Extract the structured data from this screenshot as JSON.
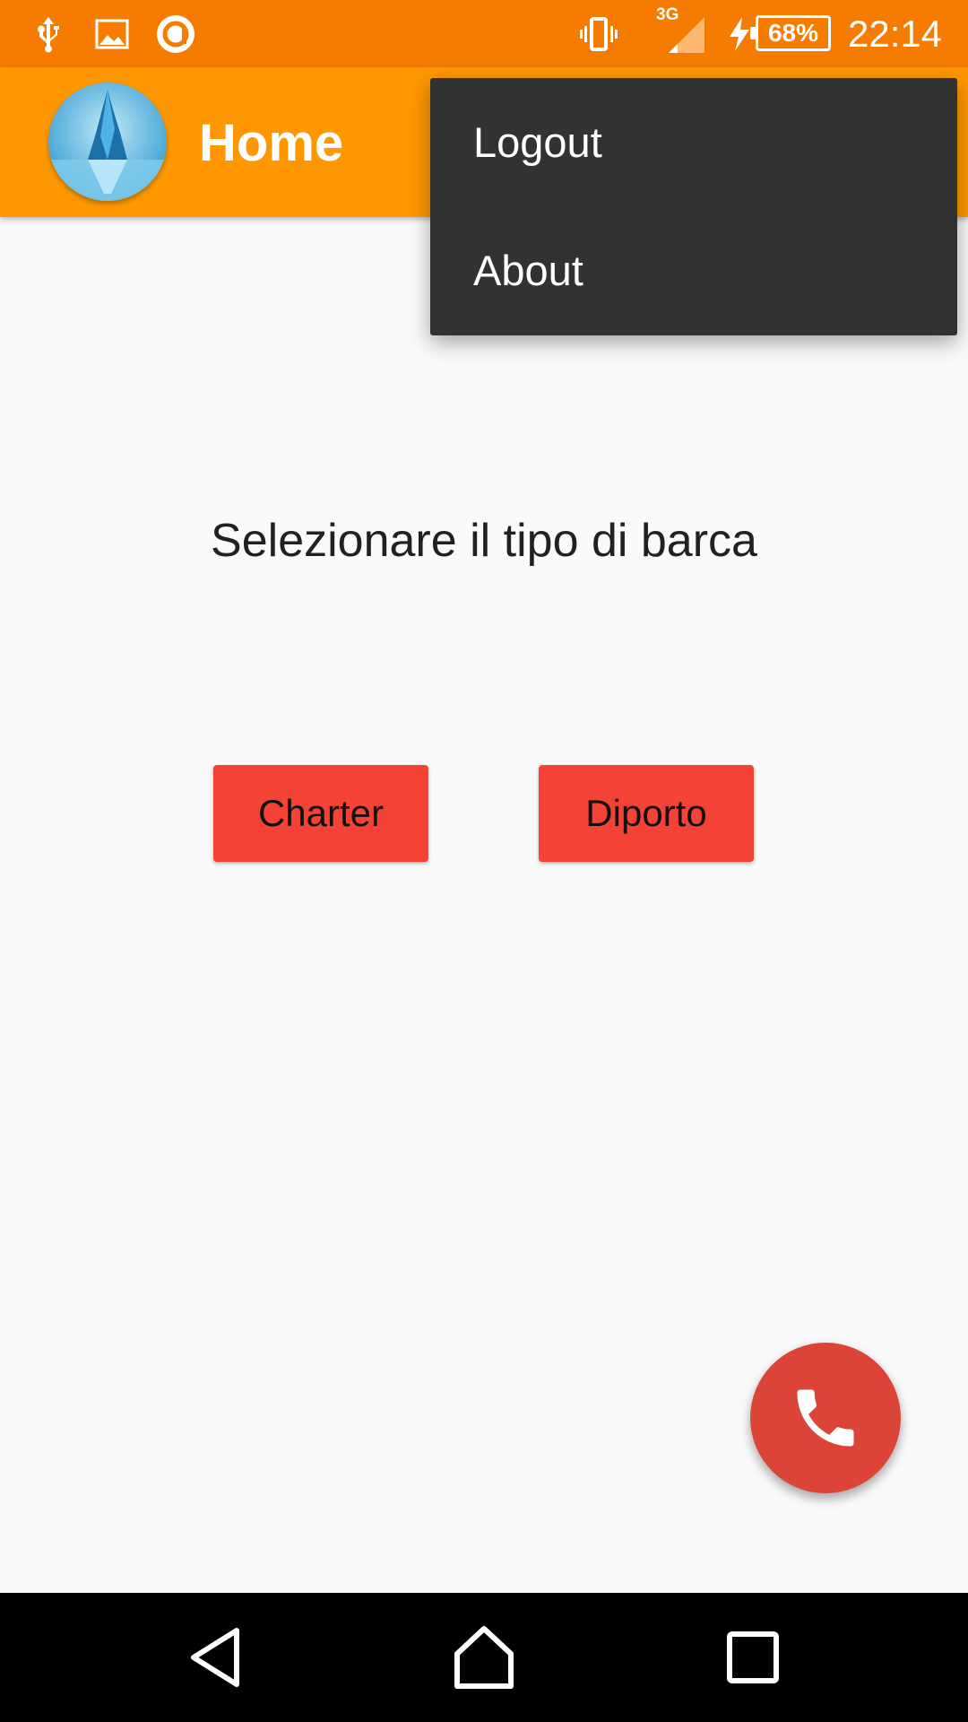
{
  "status_bar": {
    "left_icons": [
      "usb-icon",
      "image-icon",
      "app-notification-icon"
    ],
    "right_icons": [
      "vibrate-icon",
      "signal-icon",
      "charging-icon",
      "battery-icon"
    ],
    "network": "3G",
    "battery": "68%",
    "time": "22:14"
  },
  "app_bar": {
    "logo_icon": "iceberg-logo-icon",
    "title": "Home"
  },
  "overflow_menu": {
    "items": [
      {
        "label": "Logout"
      },
      {
        "label": "About"
      }
    ]
  },
  "main": {
    "prompt": "Selezionare il tipo di barca",
    "buttons": {
      "charter": "Charter",
      "diporto": "Diporto"
    }
  },
  "fab": {
    "icon": "phone-icon"
  },
  "nav_bar": {
    "icons": [
      "back-icon",
      "home-icon",
      "recents-icon"
    ]
  },
  "colors": {
    "status_bar": "#f57c00",
    "app_bar": "#ff9800",
    "menu_bg": "#323232",
    "button": "#f44336",
    "fab": "#db4437"
  }
}
